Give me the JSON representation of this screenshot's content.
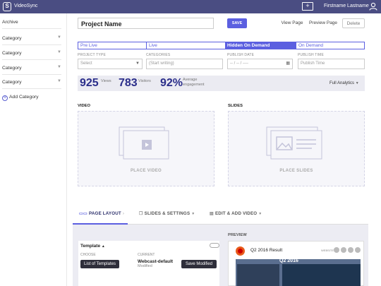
{
  "app": {
    "name": "VideoSync",
    "user": "Firstname Lastname",
    "new_icon": "plus-square-icon",
    "user_icon": "user-icon"
  },
  "sidebar": {
    "items": [
      {
        "label": "Archive"
      },
      {
        "label": "Category"
      },
      {
        "label": "Category"
      },
      {
        "label": "Category"
      },
      {
        "label": "Category"
      }
    ],
    "add_label": "Add Category"
  },
  "header": {
    "project_name": "Project Name",
    "save_label": "SAVE",
    "view_page": "View Page",
    "preview_page": "Preview Page",
    "delete": "Delete"
  },
  "pipeline": {
    "stages": [
      "Pre Live",
      "Live",
      "Hidden On Demand",
      "On Demand"
    ],
    "active_index": 2
  },
  "fields": {
    "project_type": {
      "label": "PROJECT TYPE",
      "value": "Select"
    },
    "categories": {
      "label": "CATEGORIES",
      "placeholder": "(Start writing)"
    },
    "publish_date": {
      "label": "PUBLISH DATE",
      "value": "-- / -- / ----"
    },
    "publish_time": {
      "label": "PUBLISH TIME",
      "placeholder": "Publish Time"
    }
  },
  "stats": {
    "views": {
      "value": "925",
      "label": "Views"
    },
    "visitors": {
      "value": "783",
      "label": "Visitors"
    },
    "engagement": {
      "value": "92%",
      "label_line1": "Average",
      "label_line2": "engagement"
    },
    "full_analytics": "Full Analytics"
  },
  "media": {
    "video_title": "VIDEO",
    "video_placeholder": "PLACE VIDEO",
    "slides_title": "SLIDES",
    "slides_placeholder": "PLACE SLIDES"
  },
  "bottom": {
    "tabs": [
      {
        "label": "PAGE LAYOUT",
        "icon": "layout-icon"
      },
      {
        "label": "SLIDES & SETTINGS",
        "icon": "slides-icon"
      },
      {
        "label": "EDIT & ADD VIDEO",
        "icon": "film-icon"
      }
    ],
    "template": {
      "title": "Template",
      "choose_label": "CHOOSE",
      "current_label": "CURRENT",
      "list_button": "List of Templates",
      "current_name": "Webcast-default",
      "current_status": "Modified",
      "save_modified": "Save Modified"
    },
    "preview": {
      "label": "PREVIEW",
      "title": "Q2 2016 Result",
      "share": "WEBSITE",
      "overlay_line1": "Financial results for",
      "overlay_line2": "Q2 2016"
    }
  },
  "colors": {
    "topbar": "#4a4d82",
    "accent": "#5b5fe0",
    "stat_number": "#2b2e8a"
  }
}
